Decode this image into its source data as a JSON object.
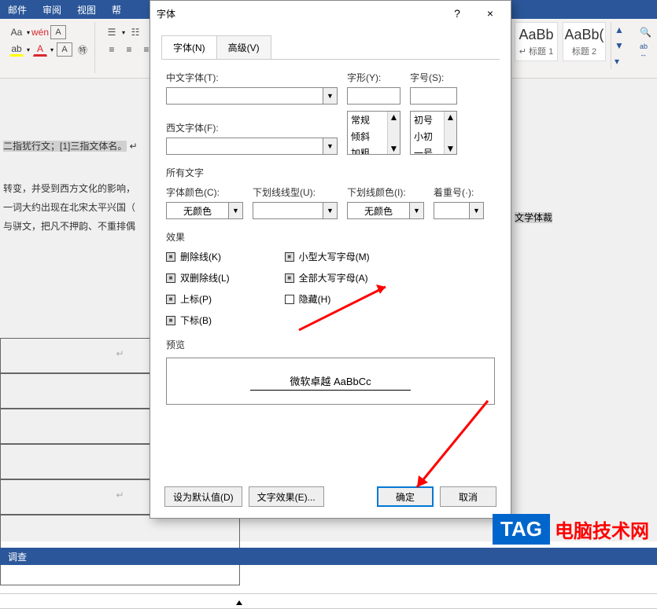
{
  "ribbon": {
    "tabs": [
      "邮件",
      "审阅",
      "视图",
      "帮"
    ],
    "fontControls": {
      "aa": "Aa",
      "wen": "wén",
      "a": "A"
    },
    "styles": [
      {
        "sample": "AaBb",
        "label": "↵ 标题 1"
      },
      {
        "sample": "AaBb(",
        "label": "标题 2"
      }
    ]
  },
  "doc": {
    "line1": "二指犹行文；[1]三指文体名。",
    "line2": "转变，并受到西方文化的影响，",
    "line3": "一词大约出现在北宋太平兴国（",
    "line4": "与骈文，把凡不押韵、不重排偶",
    "line5": "文学体裁"
  },
  "dialog": {
    "title": "字体",
    "help": "?",
    "close": "×",
    "tabs": {
      "font": "字体(N)",
      "adv": "高级(V)"
    },
    "chinese": {
      "label": "中文字体(T):"
    },
    "western": {
      "label": "西文字体(F):"
    },
    "style": {
      "label": "字形(Y):",
      "items": [
        "常规",
        "倾斜",
        "加粗"
      ]
    },
    "size": {
      "label": "字号(S):",
      "items": [
        "初号",
        "小初",
        "一号"
      ]
    },
    "allText": "所有文字",
    "fontColor": {
      "label": "字体颜色(C):",
      "value": "无颜色"
    },
    "underlineStyle": {
      "label": "下划线线型(U):"
    },
    "underlineColor": {
      "label": "下划线颜色(I):",
      "value": "无颜色"
    },
    "emphasis": {
      "label": "着重号(·):"
    },
    "effects": "效果",
    "eff": {
      "strike": "删除线(K)",
      "dstrike": "双删除线(L)",
      "sup": "上标(P)",
      "sub": "下标(B)",
      "smallcaps": "小型大写字母(M)",
      "allcaps": "全部大写字母(A)",
      "hidden": "隐藏(H)"
    },
    "preview": "预览",
    "previewSample": "微软卓越  AaBbCc",
    "setDefault": "设为默认值(D)",
    "textEffects": "文字效果(E)...",
    "ok": "确定",
    "cancel": "取消"
  },
  "status": {
    "left": "调查"
  },
  "watermark": {
    "tag": "TAG",
    "text": "电脑技术网"
  }
}
